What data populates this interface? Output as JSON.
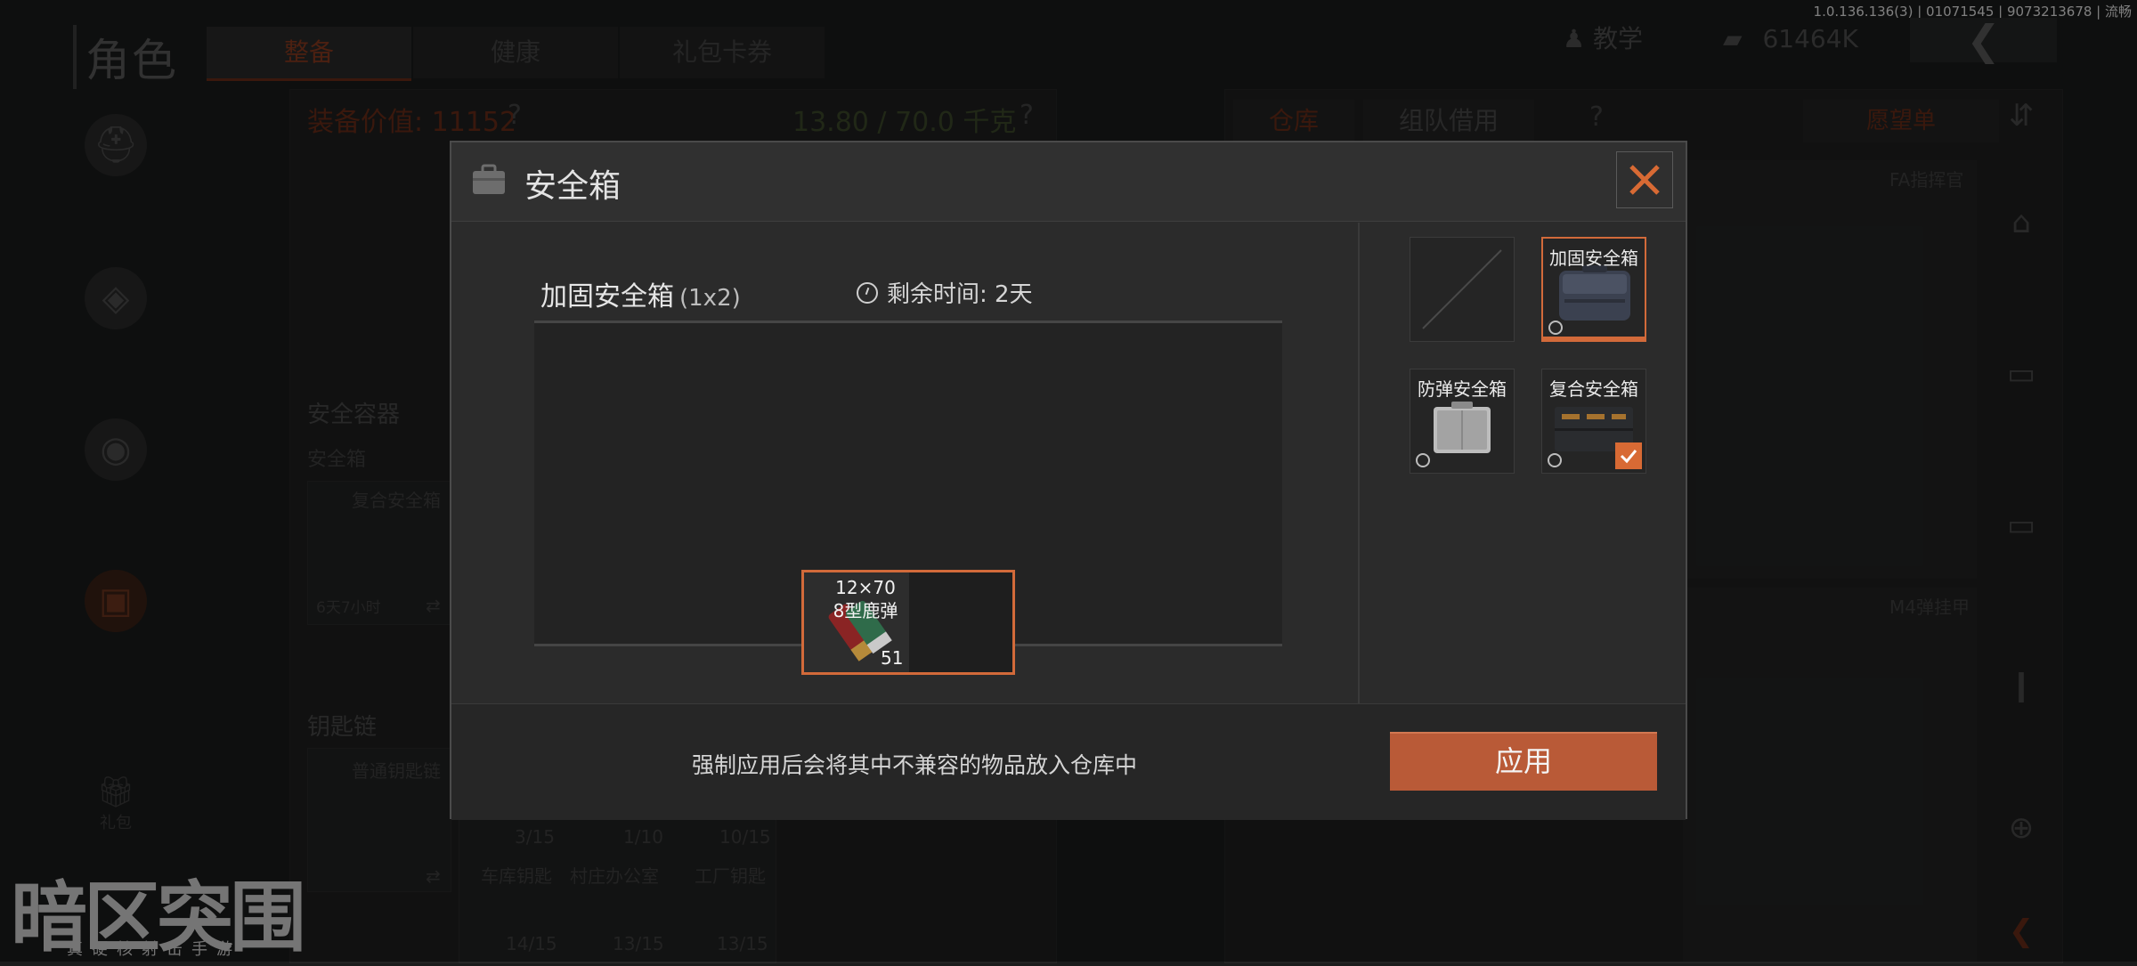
{
  "version": "1.0.136.136(3) | 01071545 | 9073213678 | 流畅",
  "header": {
    "title": "角色",
    "tabs": [
      "整备",
      "健康",
      "礼包卡券"
    ],
    "tutorial_label": "教学",
    "money": "61464K"
  },
  "left_panel": {
    "equip_value": "装备价值: 11152",
    "weight": "13.80 / 70.0 千克",
    "secure_container_title": "安全容器",
    "secure_case_label": "安全箱",
    "current_case_name": "复合安全箱",
    "current_case_time": "6天7小时",
    "keychain_title": "钥匙链",
    "keychain_name": "普通钥匙链",
    "gift_label": "礼包",
    "keys": [
      {
        "count": "3/15"
      },
      {
        "count": "1/10"
      },
      {
        "count": "10/15"
      }
    ],
    "keys_row2": [
      {
        "name": "车库钥匙",
        "count": "14/15"
      },
      {
        "name": "村庄办公室",
        "count": "13/15"
      },
      {
        "name": "工厂钥匙",
        "count": "13/15"
      }
    ]
  },
  "right_panel": {
    "tabs": [
      "仓库",
      "组队借用"
    ],
    "wishlist": "愿望单",
    "slot1": "FA指挥官",
    "slot2": "M4弹挂甲"
  },
  "logo": {
    "main": "暗区突围",
    "sub": "真硬核射击手游"
  },
  "modal": {
    "title": "安全箱",
    "case_name": "加固安全箱",
    "case_size": "(1x2)",
    "remaining_time": "剩余时间: 2天",
    "item": {
      "name_line1": "12×70",
      "name_line2": "8型鹿弹",
      "count": "51"
    },
    "cases": [
      {
        "label": "",
        "state": "empty"
      },
      {
        "label": "加固安全箱",
        "state": "selected"
      },
      {
        "label": "防弹安全箱",
        "state": "normal"
      },
      {
        "label": "复合安全箱",
        "state": "equipped"
      }
    ],
    "footer_text": "强制应用后会将其中不兼容的物品放入仓库中",
    "apply_label": "应用"
  },
  "colors": {
    "accent": "#d26a3a",
    "apply_button": "#b95a37",
    "modal_bg": "#2b2b2b"
  }
}
